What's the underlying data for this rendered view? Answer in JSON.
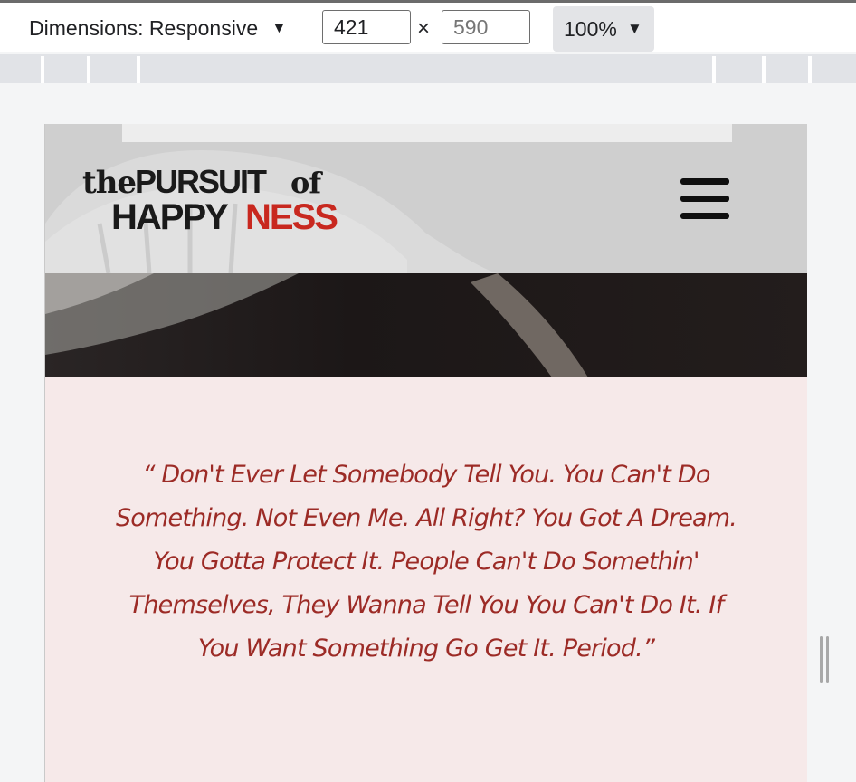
{
  "devtools": {
    "dimensions_label": "Dimensions: Responsive",
    "width_value": "421",
    "height_placeholder": "590",
    "times_symbol": "×",
    "zoom_label": "100%"
  },
  "site": {
    "logo": {
      "line1_prefix": "the",
      "line1_main": "PURSUIT",
      "line1_suffix": "of",
      "line2_main": "HAPPY",
      "line2_accent": "NESS"
    },
    "quote": "“ Don't Ever Let Somebody Tell You. You Can't Do Something. Not Even Me. All Right? You Got A Dream. You Gotta Protect It. People Can't Do Somethin' Themselves, They Wanna Tell You You Can't Do It. If You Want Something Go Get It. Period.”"
  },
  "colors": {
    "accent_red": "#c8281f",
    "quote_text": "#9c2b26",
    "page_bg": "#f6e9e9"
  },
  "icons": {
    "menu": "hamburger-menu-icon",
    "dropdown": "caret-down-icon",
    "resize": "resize-handle-icon"
  }
}
